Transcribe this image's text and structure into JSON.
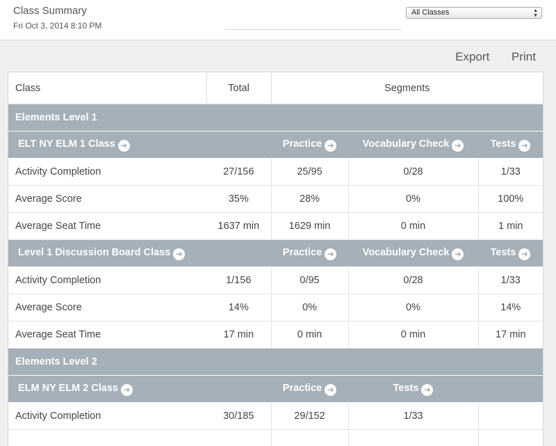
{
  "header": {
    "title": "Class Summary",
    "date": "Fri Oct 3, 2014 8:10 PM",
    "filter_value": "All Classes",
    "export_label": "Export",
    "print_label": "Print"
  },
  "table": {
    "headers": [
      "Class",
      "Total",
      "Segments"
    ],
    "groups": [
      {
        "name": "Elements Level 1",
        "classes": [
          {
            "name": "ELT NY ELM 1 Class",
            "segments": [
              "Practice",
              "Vocabulary Check",
              "Tests"
            ],
            "rows": [
              {
                "label": "Activity Completion",
                "total": "27/156",
                "s1": "25/95",
                "s2": "0/28",
                "s3": "1/33"
              },
              {
                "label": "Average Score",
                "total": "35%",
                "s1": "28%",
                "s2": "0%",
                "s3": "100%"
              },
              {
                "label": "Average Seat Time",
                "total": "1637 min",
                "s1": "1629 min",
                "s2": "0 min",
                "s3": "1 min"
              }
            ]
          },
          {
            "name": "Level 1 Discussion Board Class",
            "segments": [
              "Practice",
              "Vocabulary Check",
              "Tests"
            ],
            "rows": [
              {
                "label": "Activity Completion",
                "total": "1/156",
                "s1": "0/95",
                "s2": "0/28",
                "s3": "1/33"
              },
              {
                "label": "Average Score",
                "total": "14%",
                "s1": "0%",
                "s2": "0%",
                "s3": "14%"
              },
              {
                "label": "Average Seat Time",
                "total": "17 min",
                "s1": "0 min",
                "s2": "0 min",
                "s3": "17 min"
              }
            ]
          }
        ]
      },
      {
        "name": "Elements Level 2",
        "classes": [
          {
            "name": "ELM NY ELM 2 Class",
            "segments": [
              "Practice",
              "Tests"
            ],
            "rows": [
              {
                "label": "Activity Completion",
                "total": "30/185",
                "s1": "29/152",
                "s2": "1/33",
                "s3": ""
              }
            ]
          }
        ]
      }
    ]
  },
  "icons": {
    "segment_link": "circle-arrow-right-icon"
  },
  "colors": {
    "group_row": "#a5b0b8",
    "background": "#efefef"
  }
}
